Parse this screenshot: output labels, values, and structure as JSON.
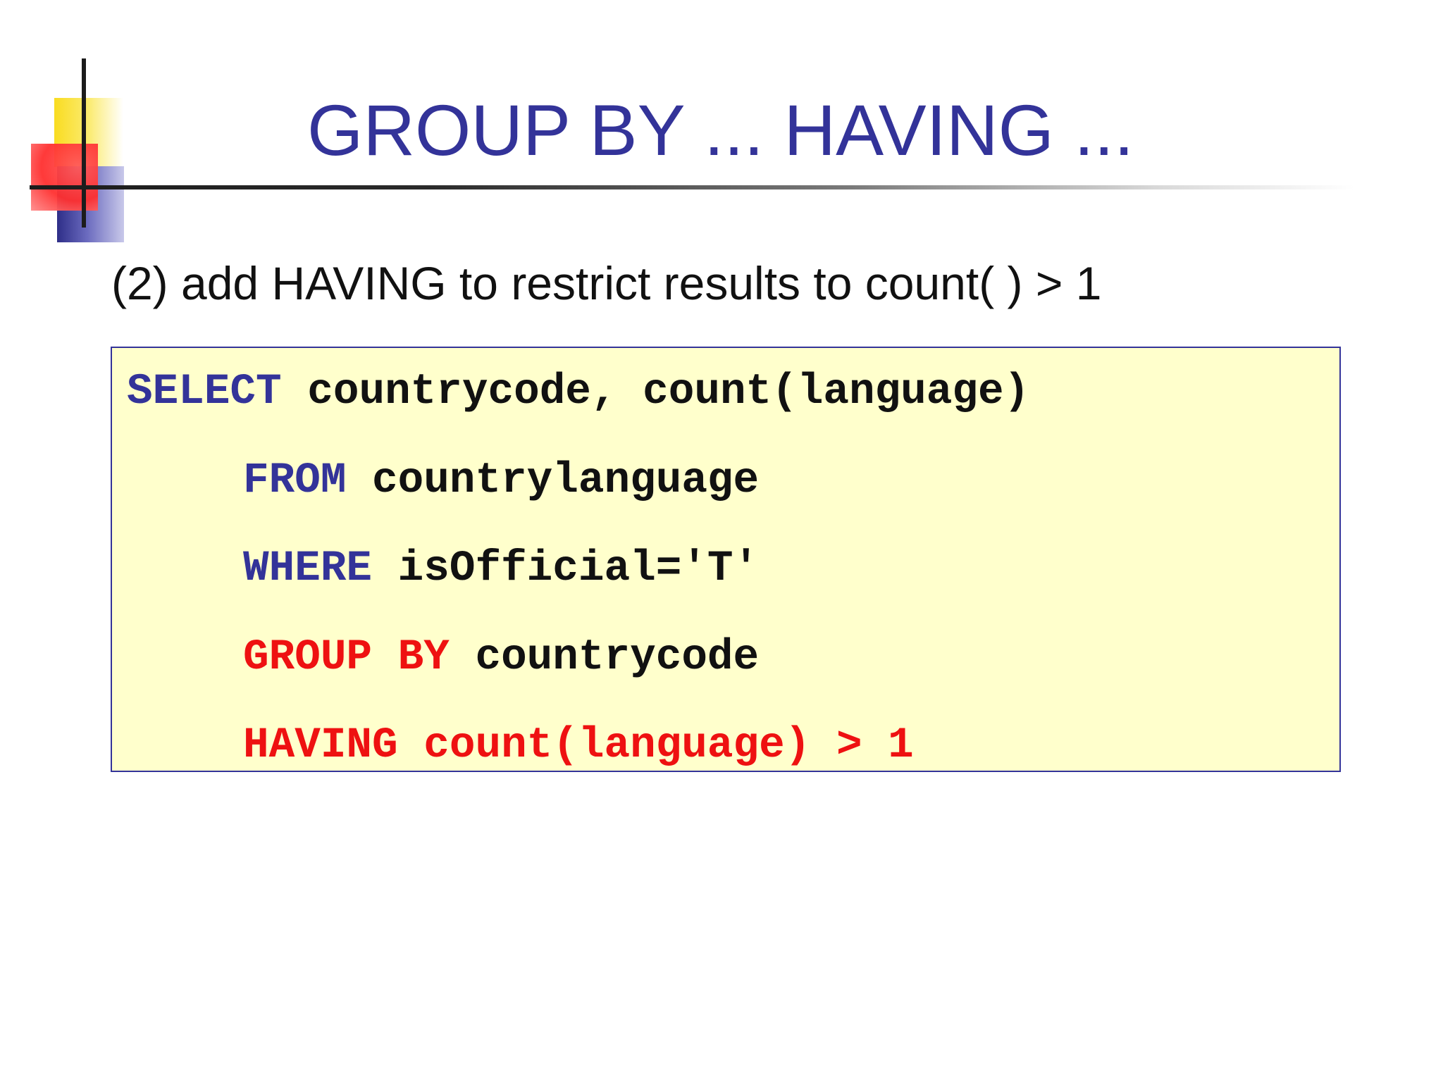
{
  "slide": {
    "title": "GROUP BY ... HAVING ...",
    "subtitle": "(2) add HAVING to restrict results to count( ) > 1"
  },
  "code": {
    "line1": {
      "keyword": "SELECT",
      "text": " countrycode, count(language)"
    },
    "line2": {
      "keyword": "FROM",
      "text": " countrylanguage"
    },
    "line3": {
      "keyword": "WHERE",
      "text": " isOfficial='T'"
    },
    "line4": {
      "keyword": "GROUP BY",
      "text": " countrycode"
    },
    "line5": {
      "keyword": "HAVING",
      "text": " count(language) > 1"
    }
  },
  "colors": {
    "title": "#333399",
    "keyword_blue": "#333399",
    "keyword_red": "#ee1111",
    "code_background": "#ffffcc"
  }
}
